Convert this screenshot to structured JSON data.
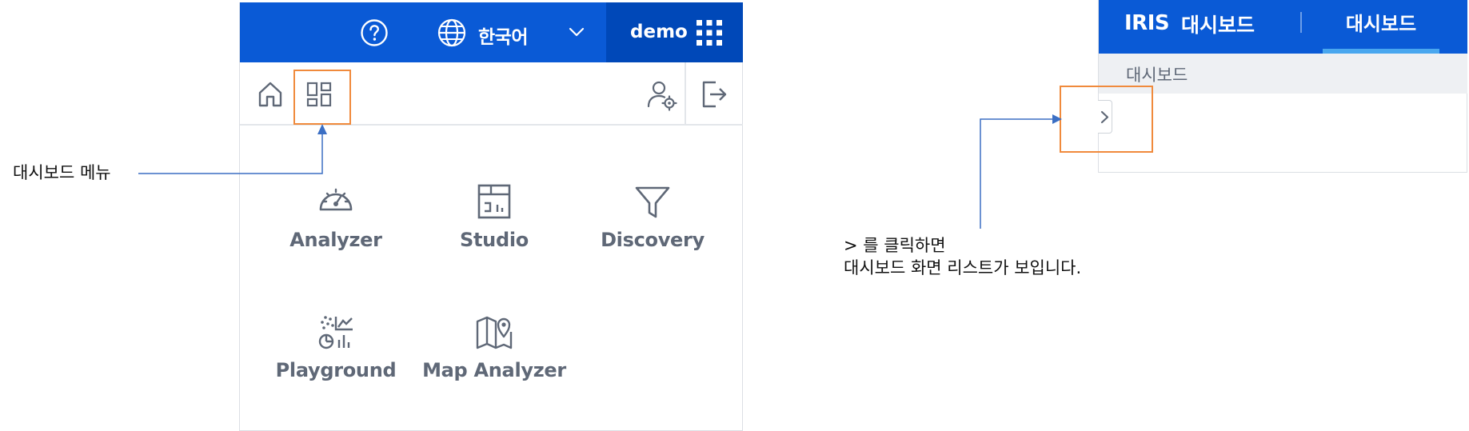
{
  "left_panel": {
    "topbar": {
      "language": "한국어",
      "user": "demo",
      "icons": {
        "help": "help-circle-icon",
        "globe": "globe-icon",
        "chevron": "chevron-down-icon",
        "apps": "apps-grid-icon"
      }
    },
    "toolbar": {
      "icons": {
        "home": "home-icon",
        "dashboard": "dashboard-icon",
        "user_settings": "user-settings-icon",
        "logout": "logout-icon"
      }
    },
    "apps": [
      {
        "label": "Analyzer",
        "icon": "gauge-icon"
      },
      {
        "label": "Studio",
        "icon": "studio-icon"
      },
      {
        "label": "Discovery",
        "icon": "filter-icon"
      },
      {
        "label": "Playground",
        "icon": "playground-icon"
      },
      {
        "label": "Map Analyzer",
        "icon": "map-pin-icon"
      }
    ]
  },
  "annotations": {
    "dashboard_menu": "대시보드 메뉴",
    "click_note_line1": "> 를 클릭하면",
    "click_note_line2": "대시보드 화면 리스트가 보입니다."
  },
  "right_panel": {
    "brand": "IRIS",
    "brand_sub": "대시보드",
    "active_tab": "대시보드",
    "breadcrumb": "대시보드",
    "toggle_icon": "chevron-right-icon"
  },
  "colors": {
    "header_blue": "#0a5ad6",
    "user_box_blue": "#0048b8",
    "highlight_orange": "#f08a3c",
    "arrow_blue": "#3b6fc4",
    "icon_gray": "#5f6877",
    "tab_underline": "#49a7ef"
  }
}
